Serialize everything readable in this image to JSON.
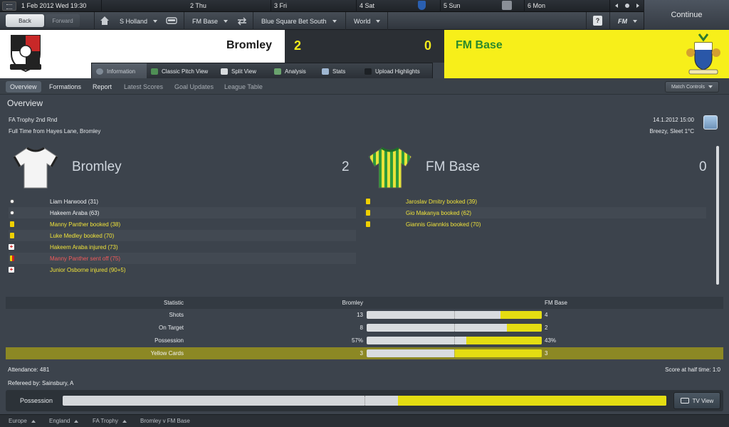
{
  "topbar": {
    "date": "1 Feb 2012 Wed 19:30",
    "days": [
      "2 Thu",
      "3 Fri",
      "4 Sat",
      "5 Sun",
      "6 Mon"
    ],
    "continue_label": "Continue"
  },
  "navbar": {
    "back_label": "Back",
    "forward_label": "Forward",
    "club": "S Holland",
    "team": "FM Base",
    "league": "Blue Square Bet South",
    "world": "World",
    "help": "?",
    "fm_menu": "FM"
  },
  "header": {
    "home_name": "Bromley",
    "home_score": "2",
    "away_score": "0",
    "away_name": "FM Base",
    "colors": {
      "home_bg": "#ffffff",
      "score_bg": "#2b2f34",
      "away_bg": "#f7ef1a",
      "score_text": "#f2ea1c",
      "away_text": "#2c8a2c"
    }
  },
  "tabs": [
    {
      "label": "Information",
      "icon": "info-icon"
    },
    {
      "label": "Classic Pitch View",
      "icon": "pitch-icon"
    },
    {
      "label": "Split View",
      "icon": "split-view-icon"
    },
    {
      "label": "Analysis",
      "icon": "analysis-icon"
    },
    {
      "label": "Stats",
      "icon": "stats-icon"
    },
    {
      "label": "Upload Highlights",
      "icon": "camera-icon"
    }
  ],
  "subnav": {
    "items": [
      "Overview",
      "Formations",
      "Report",
      "Latest Scores",
      "Goal Updates",
      "League Table"
    ],
    "match_controls": "Match Controls"
  },
  "overview": {
    "title": "Overview",
    "competition": "FA Trophy 2nd Rnd",
    "result_text": "Full Time from Hayes Lane, Bromley",
    "datetime": "14.1.2012 15:00",
    "weather": "Breezy, Sleet 1°C",
    "home_team": "Bromley",
    "home_goals": "2",
    "away_team": "FM Base",
    "away_goals": "0",
    "home_events": [
      {
        "text": "Liam Harwood (31)",
        "type": "goal"
      },
      {
        "text": "Hakeem Araba (63)",
        "type": "goal"
      },
      {
        "text": "Manny Panther booked (38)",
        "type": "yellow"
      },
      {
        "text": "Luke Medley booked (70)",
        "type": "yellow"
      },
      {
        "text": "Hakeem Araba injured (73)",
        "type": "injury"
      },
      {
        "text": "Manny Panther sent off (75)",
        "type": "red"
      },
      {
        "text": "Junior Osborne injured (90+5)",
        "type": "injury"
      }
    ],
    "away_events": [
      {
        "text": "Jaroslav Dmitry booked (39)",
        "type": "yellow"
      },
      {
        "text": "Gio Makanya booked (62)",
        "type": "yellow"
      },
      {
        "text": "Giannis Giannkis booked (70)",
        "type": "yellow"
      }
    ]
  },
  "stats": {
    "header": {
      "label": "Statistic",
      "home": "Bromley",
      "away": "FM Base"
    },
    "rows": [
      {
        "label": "Shots",
        "home": "13",
        "away": "4",
        "away_share": 0.235
      },
      {
        "label": "On Target",
        "home": "8",
        "away": "2",
        "away_share": 0.2
      },
      {
        "label": "Possession",
        "home": "57%",
        "away": "43%",
        "away_share": 0.43
      },
      {
        "label": "Yellow Cards",
        "home": "3",
        "away": "3",
        "away_share": 0.5,
        "highlight": true
      }
    ]
  },
  "footer_info": {
    "attendance": "Attendance: 481",
    "half_time": "Score at half time: 1:0",
    "referee": "Refereed by: Sainsbury, A"
  },
  "possession": {
    "label": "Possession",
    "away_share": 0.445,
    "tv_label": "TV View"
  },
  "breadcrumb": [
    "Europe",
    "England",
    "FA Trophy",
    "Bromley v FM Base"
  ]
}
